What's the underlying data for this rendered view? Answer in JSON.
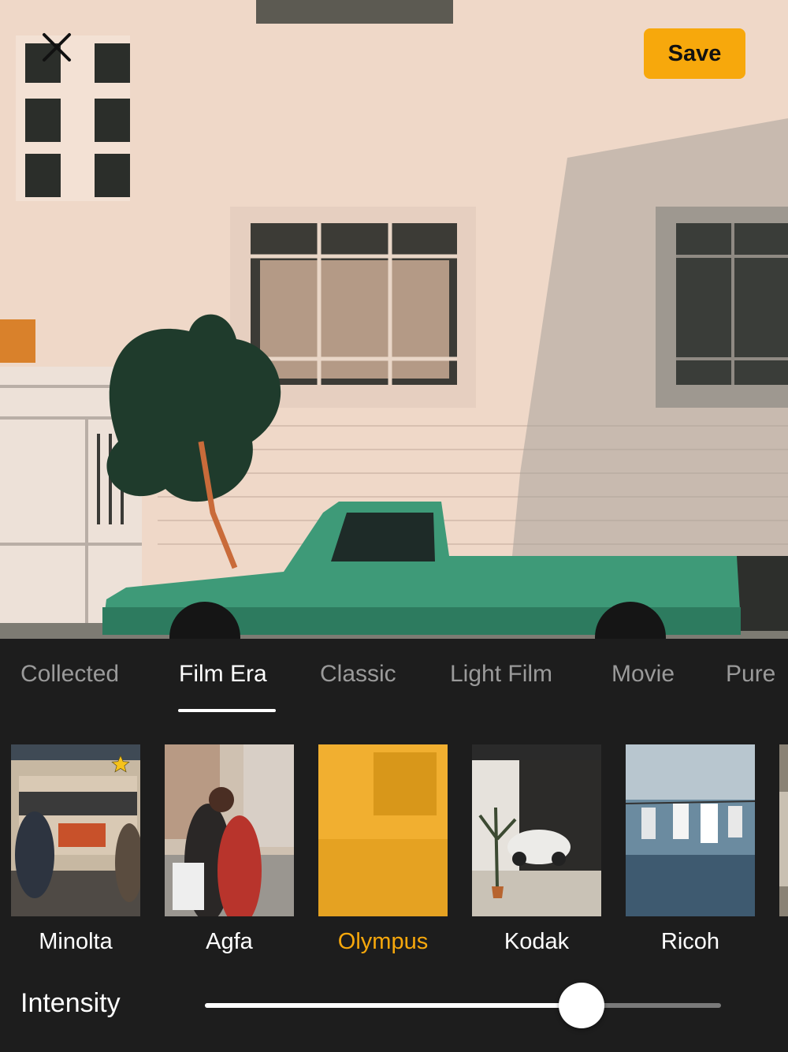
{
  "toolbar": {
    "close_icon": "close-icon",
    "save_label": "Save",
    "accent_color": "#f7a80c"
  },
  "tabs": [
    {
      "label": "Collected"
    },
    {
      "label": "Film Era"
    },
    {
      "label": "Classic"
    },
    {
      "label": "Light Film"
    },
    {
      "label": "Movie"
    },
    {
      "label": "Pure"
    }
  ],
  "active_tab": "Film Era",
  "filters": [
    {
      "label": "Minolta",
      "favorite": true
    },
    {
      "label": "Agfa"
    },
    {
      "label": "Olympus",
      "selected": true
    },
    {
      "label": "Kodak"
    },
    {
      "label": "Ricoh"
    }
  ],
  "intensity": {
    "label": "Intensity",
    "value": 0.73
  }
}
